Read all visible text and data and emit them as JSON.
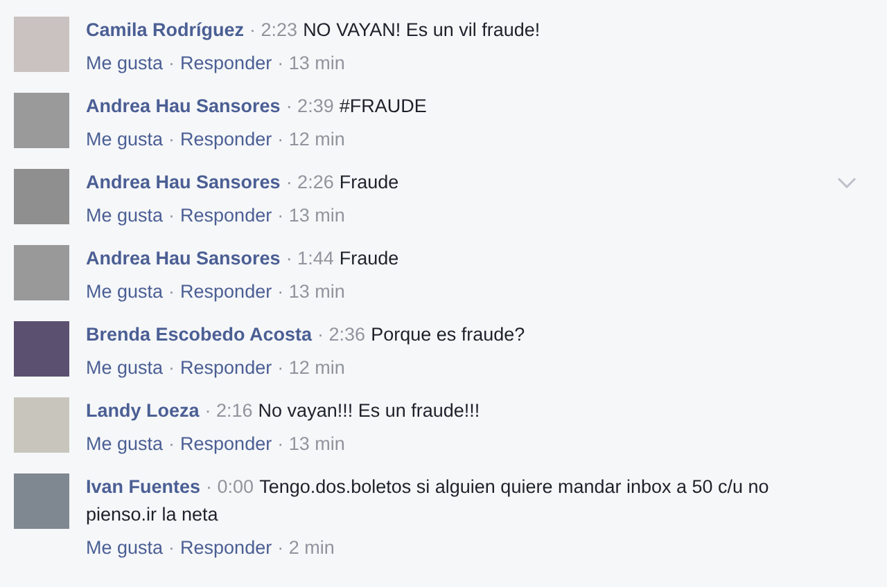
{
  "comments": [
    {
      "author": "Camila Rodríguez",
      "time": "· 2:23",
      "text": "NO VAYAN! Es un vil fraude!",
      "like": "Me gusta",
      "separator": "·",
      "reply": "Responder",
      "age": "· 13 min",
      "menu_shown": false
    },
    {
      "author": "Andrea Hau Sansores",
      "time": "· 2:39",
      "text": "#FRAUDE",
      "like": "Me gusta",
      "separator": "·",
      "reply": "Responder",
      "age": "· 12 min",
      "menu_shown": false
    },
    {
      "author": "Andrea Hau Sansores",
      "time": "· 2:26",
      "text": "Fraude",
      "like": "Me gusta",
      "separator": "·",
      "reply": "Responder",
      "age": "· 13 min",
      "menu_shown": true
    },
    {
      "author": "Andrea Hau Sansores",
      "time": "· 1:44",
      "text": "Fraude",
      "like": "Me gusta",
      "separator": "·",
      "reply": "Responder",
      "age": "· 13 min",
      "menu_shown": false
    },
    {
      "author": "Brenda Escobedo Acosta",
      "time": "· 2:36",
      "text": "Porque es fraude?",
      "like": "Me gusta",
      "separator": "·",
      "reply": "Responder",
      "age": "· 12 min",
      "menu_shown": false
    },
    {
      "author": "Landy Loeza",
      "time": "· 2:16",
      "text": "No vayan!!! Es un fraude!!!",
      "like": "Me gusta",
      "separator": "·",
      "reply": "Responder",
      "age": "· 13 min",
      "menu_shown": false
    },
    {
      "author": "Ivan Fuentes",
      "time": "· 0:00",
      "text": "Tengo.dos.boletos si alguien quiere mandar inbox a 50 c/u no pienso.ir la neta",
      "like": "Me gusta",
      "separator": "·",
      "reply": "Responder",
      "age": "· 2 min",
      "menu_shown": false
    }
  ]
}
